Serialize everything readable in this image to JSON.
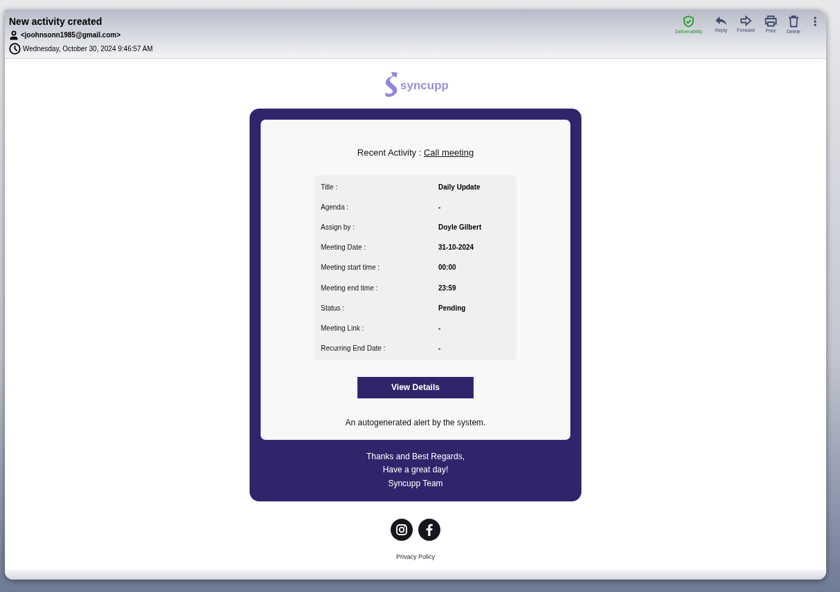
{
  "email": {
    "subject": "New activity created",
    "sender": "<joohnsonn1985@gmail.com>",
    "date": "Wednesday, October 30, 2024 9:46:57 AM"
  },
  "toolbar": [
    {
      "kind": "shield",
      "label": "Deliverability"
    },
    {
      "kind": "reply",
      "label": "Reply"
    },
    {
      "kind": "forward",
      "label": "Forward"
    },
    {
      "kind": "print",
      "label": "Print"
    },
    {
      "kind": "delete",
      "label": "Delete"
    },
    {
      "kind": "more"
    }
  ],
  "logo": {
    "text": "syncupp"
  },
  "activity": {
    "label": "Recent Activity : ",
    "link": "Call meeting"
  },
  "details": [
    {
      "label": "Title :",
      "value": "Daily Update"
    },
    {
      "label": "Agenda :",
      "value": "-"
    },
    {
      "label": "Assign by :",
      "value": "Doyle Gilbert"
    },
    {
      "label": "Meeting Date :",
      "value": "31-10-2024"
    },
    {
      "label": "Meeting start time :",
      "value": "00:00"
    },
    {
      "label": "Meeting end time :",
      "value": "23:59"
    },
    {
      "label": "Status :",
      "value": "Pending"
    },
    {
      "label": "Meeting Link :",
      "value": "-"
    },
    {
      "label": "Recurring End Date :",
      "value": "-"
    }
  ],
  "button": "View Details",
  "note": "An autogenerated alert by the system.",
  "signoff": [
    "Thanks and Best Regards,",
    "Have a great day!",
    "Syncupp Team"
  ],
  "social": [
    {
      "kind": "instagram"
    },
    {
      "kind": "facebook"
    }
  ],
  "privacy": "Privacy Policy"
}
